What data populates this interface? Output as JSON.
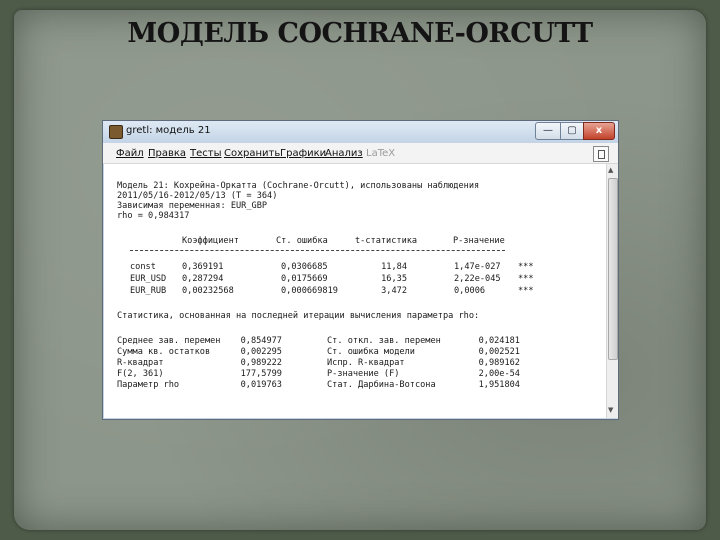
{
  "slide_title": "МОДЕЛЬ COCHRANE-ORCUTT",
  "window": {
    "title": "gretl: модель 21",
    "controls": {
      "minimize": "—",
      "maximize": "▢",
      "close": "x"
    }
  },
  "menu": [
    "Файл",
    "Правка",
    "Тесты",
    "Сохранить",
    "Графики",
    "Анализ",
    "LaTeX"
  ],
  "output": {
    "header_lines": [
      "Модель 21: Кохрейна-Оркатта (Cochrane-Orcutt), использованы наблюдения",
      "2011/05/16-2012/05/13 (T = 364)",
      "Зависимая переменная: EUR_GBP",
      "rho = 0,984317"
    ],
    "coef_headers": [
      "Коэффициент",
      "Ст. ошибка",
      "t-статистика",
      "P-значение"
    ],
    "coefficients": [
      {
        "name": "const",
        "coef": "0,369191",
        "se": "0,0306685",
        "t": "11,84",
        "p": "1,47e-027",
        "stars": "***"
      },
      {
        "name": "EUR_USD",
        "coef": "0,287294",
        "se": "0,0175669",
        "t": "16,35",
        "p": "2,22e-045",
        "stars": "***"
      },
      {
        "name": "EUR_RUB",
        "coef": "0,00232568",
        "se": "0,000669819",
        "t": "3,472",
        "p": "0,0006",
        "stars": "***"
      }
    ],
    "stats_caption": "Статистика, основанная на последней итерации вычисления параметра rho:",
    "stats": [
      {
        "l_label": "Среднее зав. перемен",
        "l_val": "0,854977",
        "r_label": "Ст. откл. зав. перемен",
        "r_val": "0,024181"
      },
      {
        "l_label": "Сумма кв. остатков",
        "l_val": "0,002295",
        "r_label": "Ст. ошибка модели",
        "r_val": "0,002521"
      },
      {
        "l_label": "R-квадрат",
        "l_val": "0,989222",
        "r_label": "Испр. R-квадрат",
        "r_val": "0,989162"
      },
      {
        "l_label": "F(2, 361)",
        "l_val": "177,5799",
        "r_label": "Р-значение (F)",
        "r_val": "2,00e-54"
      },
      {
        "l_label": "Параметр rho",
        "l_val": "0,019763",
        "r_label": "Стат. Дарбина-Вотсона",
        "r_val": "1,951804"
      }
    ]
  }
}
